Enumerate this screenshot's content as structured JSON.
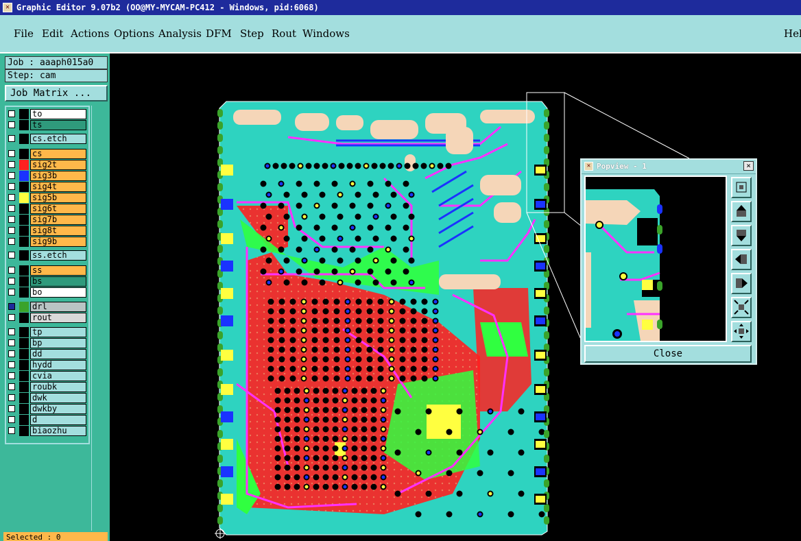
{
  "window": {
    "title": "Graphic Editor 9.07b2 (OO@MY-MYCAM-PC412 - Windows, pid:6068)"
  },
  "menu": {
    "file": "File",
    "edit": "Edit",
    "actions": "Actions",
    "options": "Options",
    "analysis": "Analysis",
    "dfm": "DFM",
    "step": "Step",
    "rout": "Rout",
    "windows": "Windows",
    "help": "Help"
  },
  "job": {
    "job_label": "Job : aaaph015a0",
    "step_label": "Step: cam",
    "matrix_button": "Job Matrix ..."
  },
  "layers": [
    {
      "name": "to",
      "swatch": "#000000",
      "bg": "#ffffff",
      "checked": false
    },
    {
      "name": "ts",
      "swatch": "#000000",
      "bg": "#2f9a7c",
      "checked": false
    },
    {
      "name": "cs.etch",
      "swatch": "#000000",
      "bg": "#a3dede",
      "checked": false
    },
    {
      "name": "cs",
      "swatch": "#000000",
      "bg": "#ffb84a",
      "checked": false
    },
    {
      "name": "sig2t",
      "swatch": "#ff2020",
      "bg": "#ffb84a",
      "checked": false
    },
    {
      "name": "sig3b",
      "swatch": "#1a33ff",
      "bg": "#ffb84a",
      "checked": false
    },
    {
      "name": "sig4t",
      "swatch": "#000000",
      "bg": "#ffb84a",
      "checked": false
    },
    {
      "name": "sig5b",
      "swatch": "#ffff40",
      "bg": "#ffb84a",
      "checked": false
    },
    {
      "name": "sig6t",
      "swatch": "#000000",
      "bg": "#ffb84a",
      "checked": false
    },
    {
      "name": "sig7b",
      "swatch": "#000000",
      "bg": "#ffb84a",
      "checked": false
    },
    {
      "name": "sig8t",
      "swatch": "#000000",
      "bg": "#ffb84a",
      "checked": false
    },
    {
      "name": "sig9b",
      "swatch": "#000000",
      "bg": "#ffb84a",
      "checked": false
    },
    {
      "name": "ss.etch",
      "swatch": "#000000",
      "bg": "#a3dede",
      "checked": false
    },
    {
      "name": "ss",
      "swatch": "#000000",
      "bg": "#ffb84a",
      "checked": false
    },
    {
      "name": "bs",
      "swatch": "#000000",
      "bg": "#2f9a7c",
      "checked": false
    },
    {
      "name": "bo",
      "swatch": "#000000",
      "bg": "#ffffff",
      "checked": false
    },
    {
      "name": "drl",
      "swatch": "#3aa32a",
      "bg": "#b9c4c4",
      "checked": true
    },
    {
      "name": "rout",
      "swatch": "#000000",
      "bg": "#d9d9d9",
      "checked": false
    },
    {
      "name": "tp",
      "swatch": "#000000",
      "bg": "#a3dede",
      "checked": false
    },
    {
      "name": "bp",
      "swatch": "#000000",
      "bg": "#a3dede",
      "checked": false
    },
    {
      "name": "dd",
      "swatch": "#000000",
      "bg": "#a3dede",
      "checked": false
    },
    {
      "name": "hydd",
      "swatch": "#000000",
      "bg": "#a3dede",
      "checked": false
    },
    {
      "name": "cvia",
      "swatch": "#000000",
      "bg": "#a3dede",
      "checked": false
    },
    {
      "name": "roubk",
      "swatch": "#000000",
      "bg": "#a3dede",
      "checked": false
    },
    {
      "name": "dwk",
      "swatch": "#000000",
      "bg": "#a3dede",
      "checked": false
    },
    {
      "name": "dwkby",
      "swatch": "#000000",
      "bg": "#a3dede",
      "checked": false
    },
    {
      "name": "d",
      "swatch": "#000000",
      "bg": "#a3dede",
      "checked": false
    },
    {
      "name": "biaozhu",
      "swatch": "#000000",
      "bg": "#a3dede",
      "checked": false
    }
  ],
  "status": {
    "selected": "Selected : 0"
  },
  "popview": {
    "title": "Popview - 1",
    "close_button": "Close",
    "close_x": "×",
    "tools": [
      "zoom-fit-icon",
      "pan-up-icon",
      "pan-down-icon",
      "pan-left-icon",
      "pan-right-icon",
      "zoom-out-icon",
      "move-icon"
    ]
  },
  "colors": {
    "board": "#2ed3c0",
    "copper_red": "#ff2020",
    "trace_magenta": "#ff30ff",
    "plane_green": "#30ff40",
    "pad_yellow": "#ffff40",
    "silk_beige": "#f5d6b8",
    "via_black": "#000000",
    "ui_cyan": "#a3dede",
    "ui_teal": "#3db89a",
    "ui_orange": "#ffb84a"
  }
}
